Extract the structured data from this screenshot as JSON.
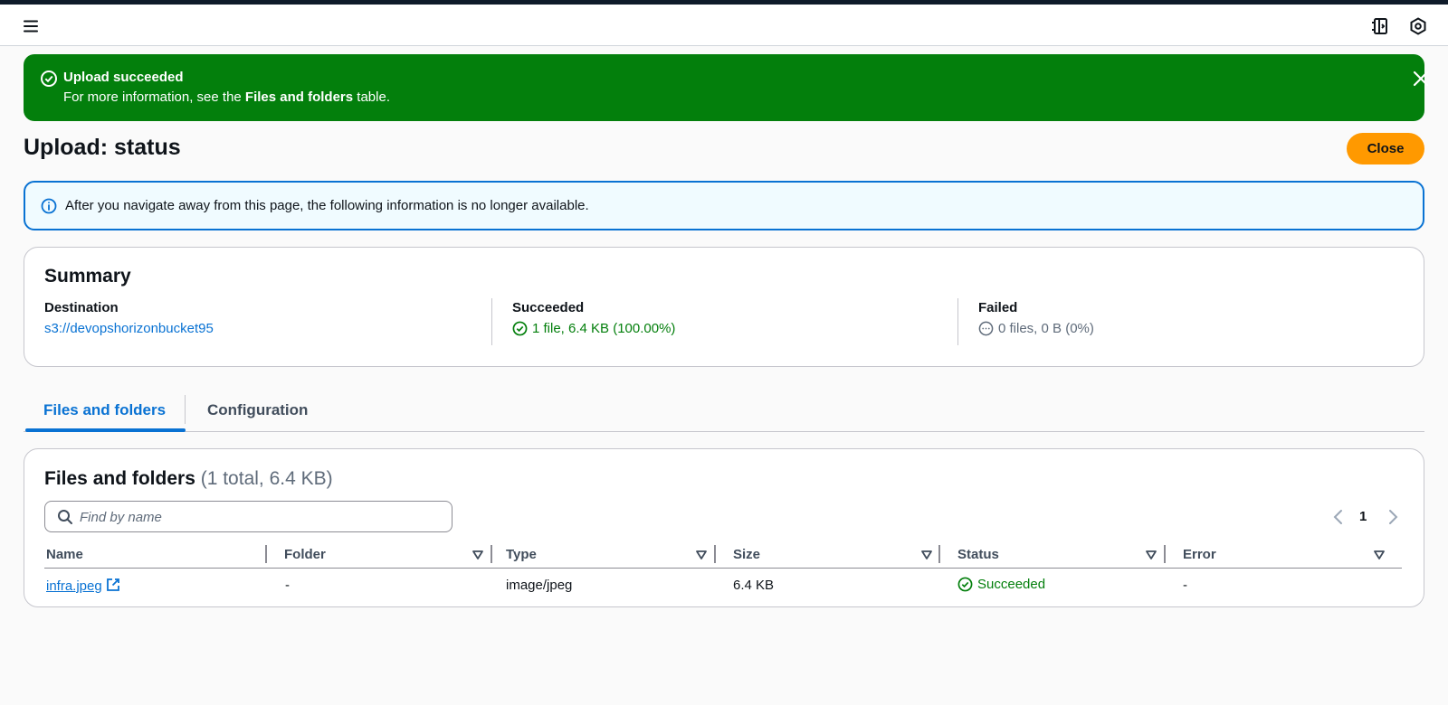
{
  "flash": {
    "title": "Upload succeeded",
    "message_prefix": "For more information, see the ",
    "message_bold": "Files and folders",
    "message_suffix": " table."
  },
  "page": {
    "title": "Upload: status",
    "close_label": "Close"
  },
  "info_alert": {
    "text": "After you navigate away from this page, the following information is no longer available."
  },
  "summary": {
    "title": "Summary",
    "destination_label": "Destination",
    "destination_value": "s3://devopshorizonbucket95",
    "succeeded_label": "Succeeded",
    "succeeded_value": "1 file, 6.4 KB (100.00%)",
    "failed_label": "Failed",
    "failed_value": "0 files, 0 B (0%)"
  },
  "tabs": [
    {
      "label": "Files and folders",
      "active": true
    },
    {
      "label": "Configuration",
      "active": false
    }
  ],
  "files": {
    "title": "Files and folders",
    "count": "(1 total, 6.4 KB)",
    "search_placeholder": "Find by name",
    "page_number": "1",
    "columns": [
      "Name",
      "Folder",
      "Type",
      "Size",
      "Status",
      "Error"
    ],
    "rows": [
      {
        "name": "infra.jpeg",
        "folder": "-",
        "type": "image/jpeg",
        "size": "6.4 KB",
        "status": "Succeeded",
        "error": "-"
      }
    ]
  },
  "colors": {
    "success": "#037f0c",
    "info_border": "#0972d3",
    "primary_button": "#ff9900",
    "link": "#0972d3"
  },
  "icons": [
    "menu-icon",
    "side-panel-icon",
    "settings-icon",
    "success-check-icon",
    "close-icon",
    "info-icon",
    "pending-icon",
    "search-icon",
    "chevron-left-icon",
    "chevron-right-icon",
    "sort-icon",
    "external-link-icon"
  ]
}
